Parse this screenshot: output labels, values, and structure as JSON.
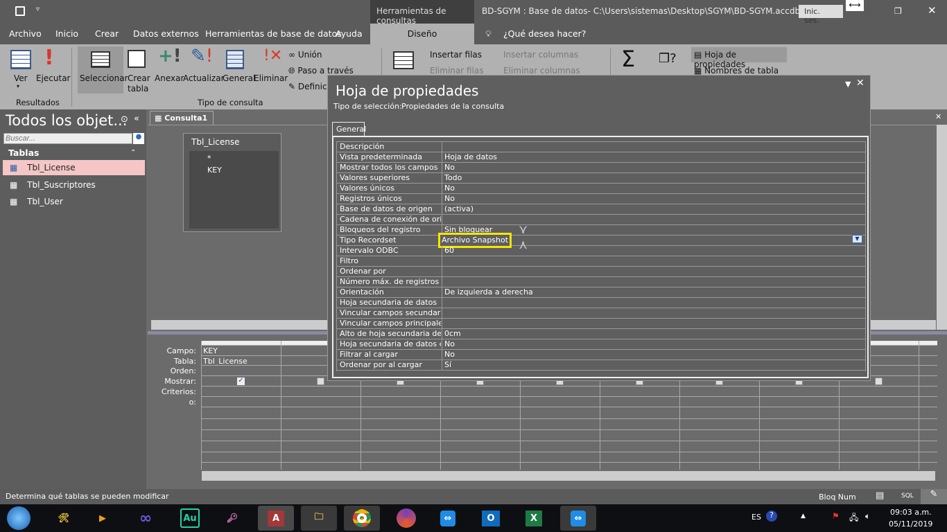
{
  "window": {
    "context_tab": "Herramientas de consultas",
    "title": "BD-SGYM : Base de datos- C:\\Users\\sistemas\\Desktop\\SGYM\\BD-SGYM.accdb (Fo...",
    "signin": "Inic. ses."
  },
  "tabs": [
    "Archivo",
    "Inicio",
    "Crear",
    "Datos externos",
    "Herramientas de base de datos",
    "Ayuda",
    "Diseño"
  ],
  "tell_me": "¿Qué desea hacer?",
  "ribbon": {
    "resultados": {
      "ver": "Ver",
      "ejecutar": "Ejecutar",
      "group": "Resultados"
    },
    "tipo": {
      "seleccionar": "Seleccionar",
      "crear_tabla": "Crear tabla",
      "anexar": "Anexar",
      "actualizar": "Actualizar",
      "general": "General",
      "eliminar": "Eliminar",
      "union": "Unión",
      "paso": "Paso a través",
      "definicion": "Definic",
      "group": "Tipo de consulta"
    },
    "config": {
      "insertar_filas": "Insertar filas",
      "eliminar_filas": "Eliminar filas",
      "insertar_columnas": "Insertar columnas",
      "eliminar_columnas": "Eliminar columnas"
    },
    "show": {
      "hoja_prop": "Hoja de propiedades",
      "nombres_tabla": "Nombres de tabla"
    }
  },
  "nav": {
    "title": "Todos los objet...",
    "search_placeholder": "Buscar...",
    "section": "Tablas",
    "items": [
      "Tbl_License",
      "Tbl_Suscriptores",
      "Tbl_User"
    ]
  },
  "doc_tab": "Consulta1",
  "table_box": {
    "title": "Tbl_License",
    "fields": [
      "*",
      "KEY"
    ]
  },
  "grid": {
    "labels": [
      "Campo:",
      "Tabla:",
      "Orden:",
      "Mostrar:",
      "Criterios:",
      "o:"
    ],
    "col1": {
      "campo": "KEY",
      "tabla": "Tbl_License",
      "mostrar": true
    }
  },
  "props": {
    "title": "Hoja de propiedades",
    "selection_label": "Tipo de selección:",
    "selection_value": "Propiedades de la consulta",
    "tab": "General",
    "rows": [
      [
        "Descripción",
        ""
      ],
      [
        "Vista predeterminada",
        "Hoja de datos"
      ],
      [
        "Mostrar todos los campos",
        "No"
      ],
      [
        "Valores superiores",
        "Todo"
      ],
      [
        "Valores únicos",
        "No"
      ],
      [
        "Registros únicos",
        "No"
      ],
      [
        "Base de datos de origen",
        "(activa)"
      ],
      [
        "Cadena de conexión de orig",
        ""
      ],
      [
        "Bloqueos del registro",
        "Sin bloquear"
      ],
      [
        "Tipo Recordset",
        "Archivo Snapshot"
      ],
      [
        "Intervalo ODBC",
        "60"
      ],
      [
        "Filtro",
        ""
      ],
      [
        "Ordenar por",
        ""
      ],
      [
        "Número máx. de registros",
        ""
      ],
      [
        "Orientación",
        "De izquierda a derecha"
      ],
      [
        "Hoja secundaria de datos",
        ""
      ],
      [
        "Vincular campos secundarios",
        ""
      ],
      [
        "Vincular campos principales",
        ""
      ],
      [
        "Alto de hoja secundaria de d",
        "0cm"
      ],
      [
        "Hoja secundaria de datos ex",
        "No"
      ],
      [
        "Filtrar al cargar",
        "No"
      ],
      [
        "Ordenar por al cargar",
        "Sí"
      ]
    ]
  },
  "status": {
    "message": "Determina qué tablas se pueden modificar",
    "bloq": "Bloq Num",
    "sql": "SQL"
  },
  "taskbar": {
    "lang": "ES",
    "time": "09:03 a.m.",
    "date": "05/11/2019"
  },
  "colors": {
    "highlight": "#f5e600",
    "selected_nav": "#f4c6c6",
    "access_red": "#a4373a"
  }
}
